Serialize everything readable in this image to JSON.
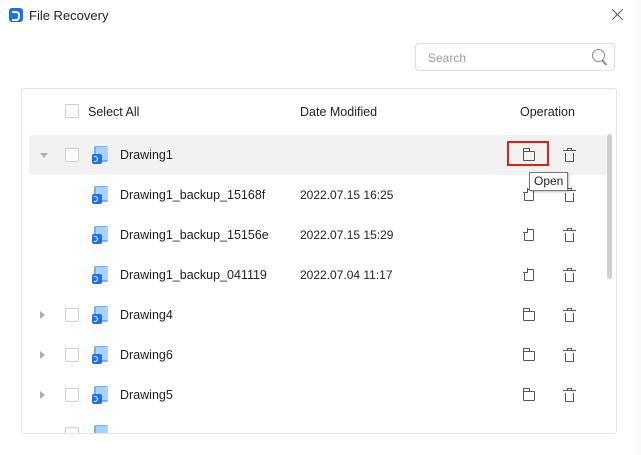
{
  "window": {
    "title": "File Recovery",
    "close_icon": "close-icon"
  },
  "search": {
    "placeholder": "Search",
    "value": ""
  },
  "table": {
    "columns": {
      "select_all": "Select All",
      "date_modified": "Date Modified",
      "operation": "Operation"
    },
    "rows": [
      {
        "name": "Drawing1",
        "date": "",
        "expander": "expanded",
        "selected": true,
        "icon": "open-folder-icon"
      },
      {
        "name": "Drawing1_backup_15168f",
        "date": "2022.07.15 16:25",
        "icon": "restore-icon"
      },
      {
        "name": "Drawing1_backup_15156e",
        "date": "2022.07.15 15:29",
        "icon": "restore-icon"
      },
      {
        "name": "Drawing1_backup_041119",
        "date": "2022.07.04 11:17",
        "icon": "restore-icon"
      },
      {
        "name": "Drawing4",
        "date": "",
        "expander": "collapsed",
        "icon": "open-folder-icon"
      },
      {
        "name": "Drawing6",
        "date": "",
        "expander": "collapsed",
        "icon": "open-folder-icon"
      },
      {
        "name": "Drawing5",
        "date": "",
        "expander": "collapsed",
        "icon": "open-folder-icon"
      }
    ]
  },
  "tooltip": {
    "text": "Open"
  },
  "colors": {
    "accent": "#1d6ef0",
    "highlight": "#e0201c",
    "selected_row": "#f2f2f2"
  }
}
